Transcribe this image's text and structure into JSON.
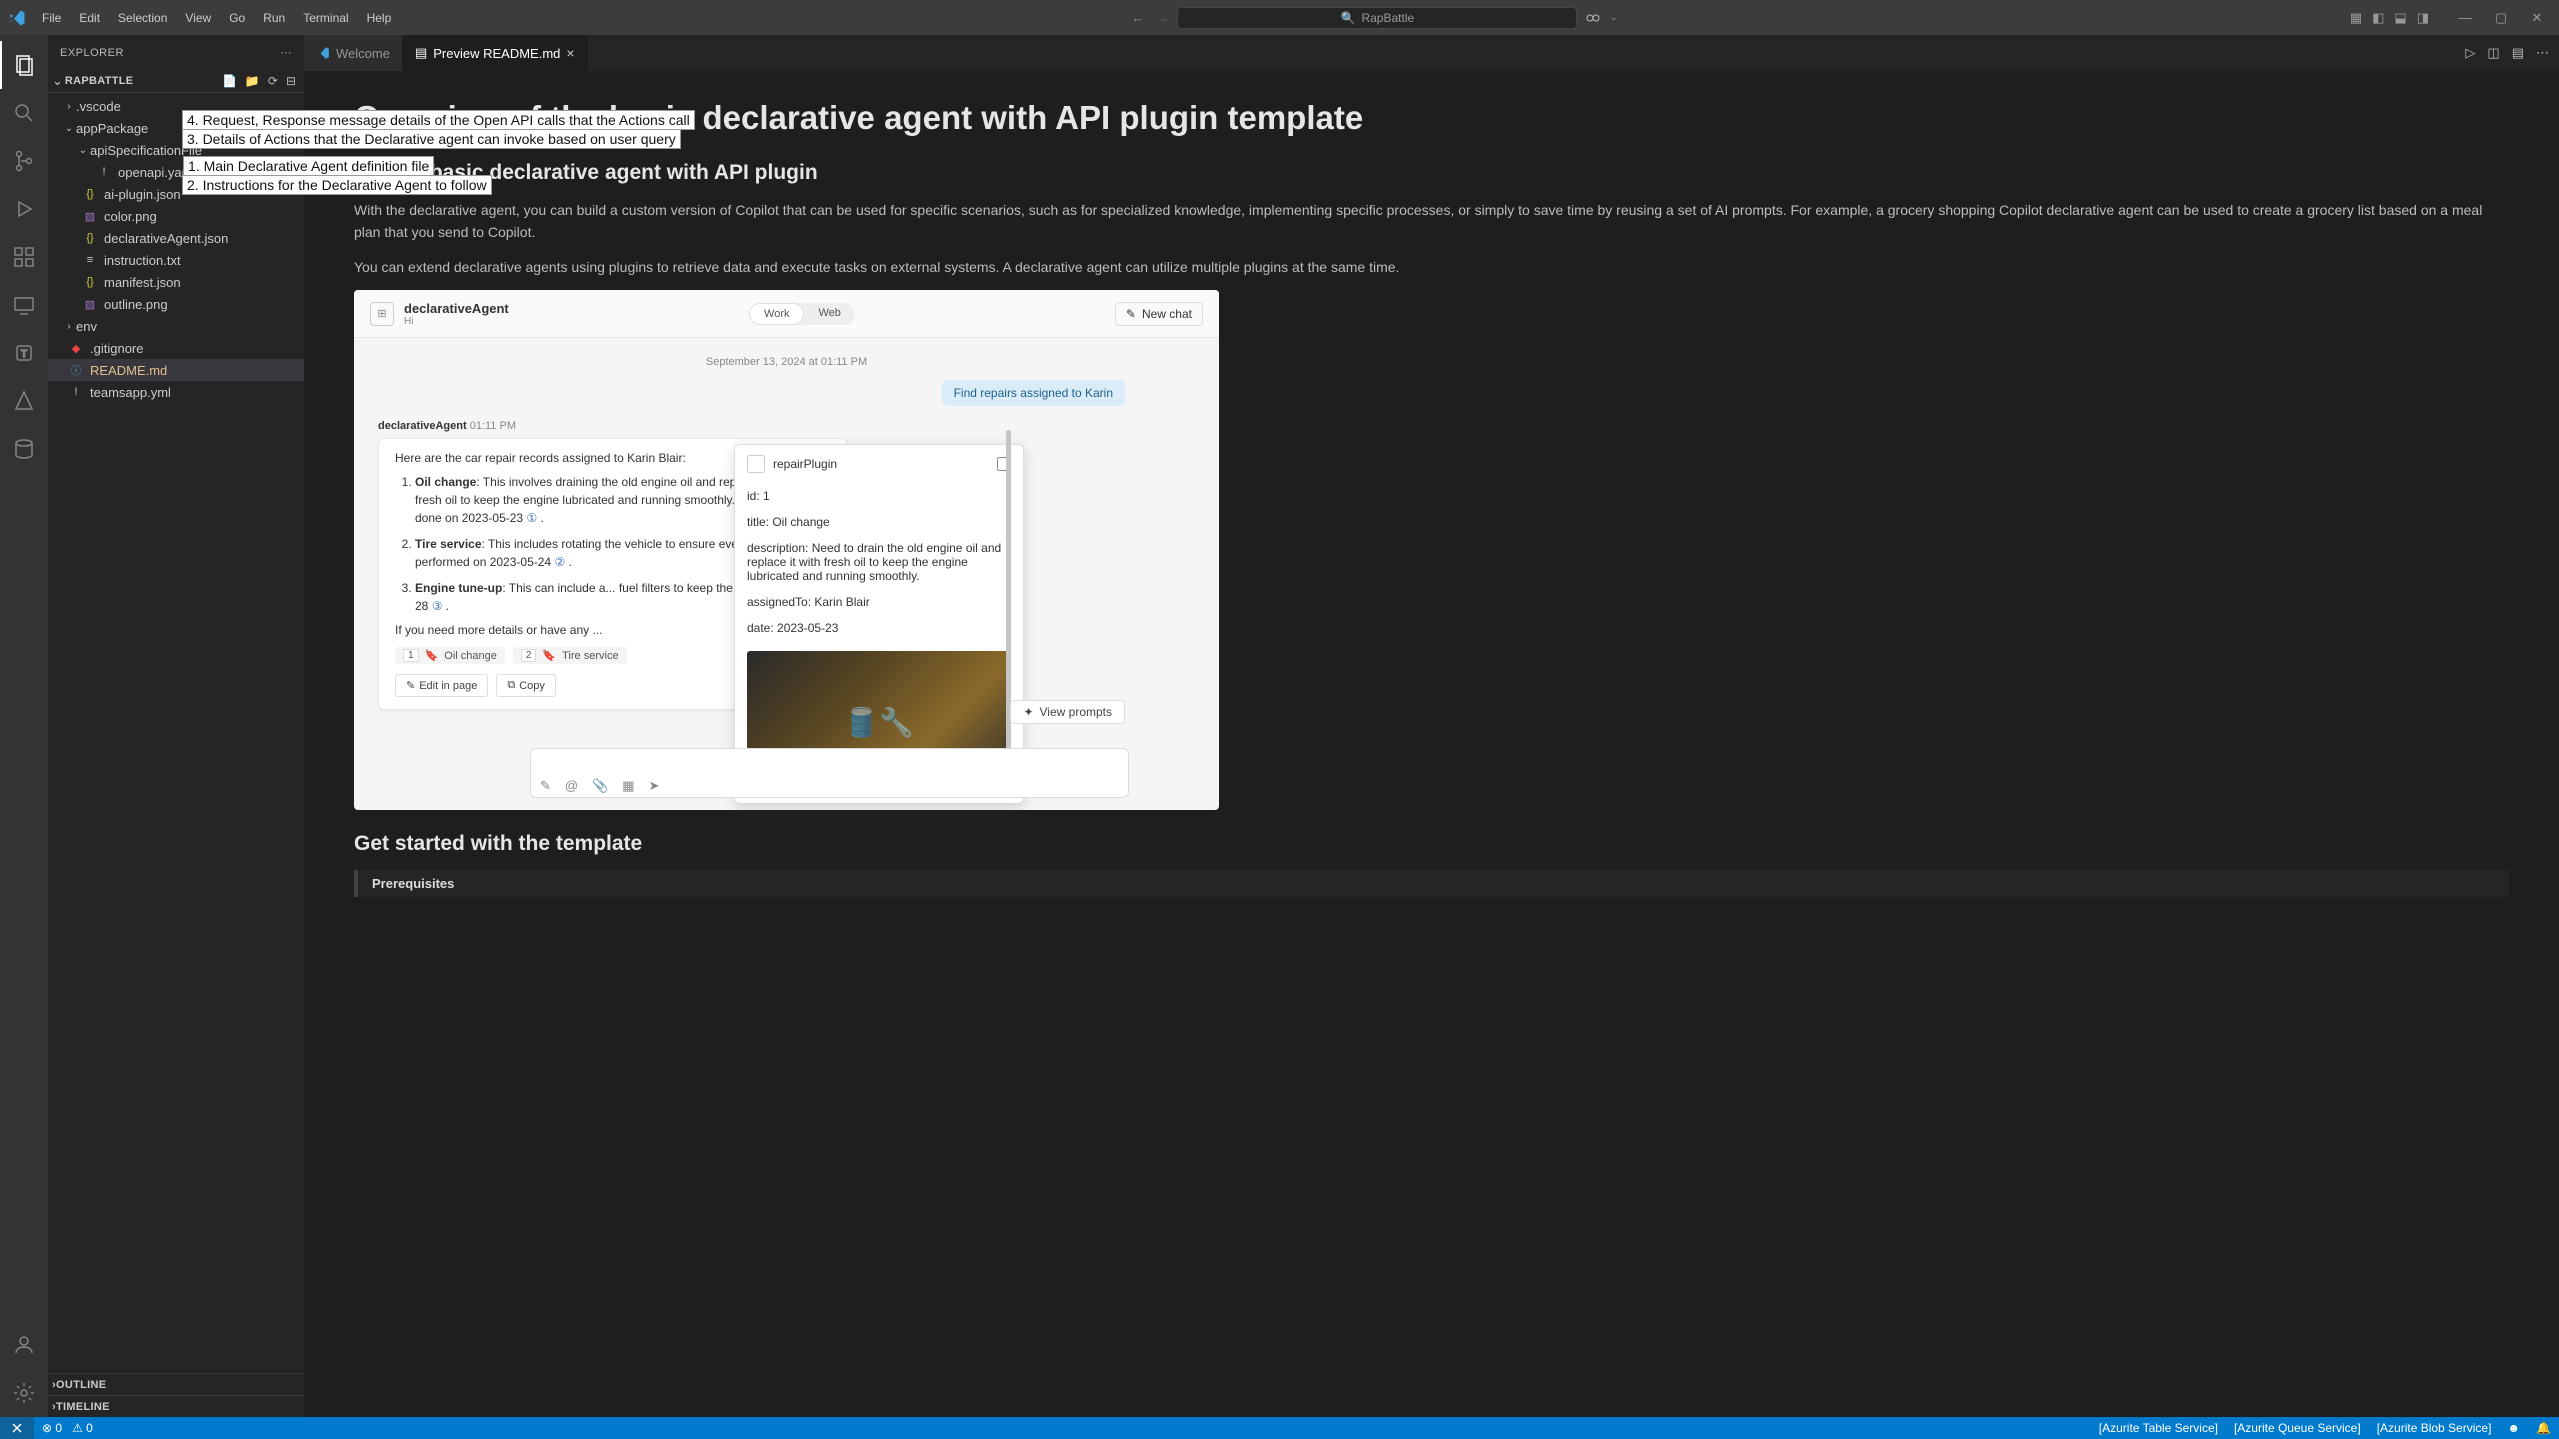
{
  "menu": {
    "items": [
      "File",
      "Edit",
      "Selection",
      "View",
      "Go",
      "Run",
      "Terminal",
      "Help"
    ]
  },
  "search_text": "RapBattle",
  "explorer_label": "EXPLORER",
  "project_name": "RAPBATTLE",
  "tree": {
    "vscode": ".vscode",
    "appPackage": "appPackage",
    "apiSpec": "apiSpecificationFile",
    "openapi": "openapi.yaml",
    "aiPlugin": "ai-plugin.json",
    "color": "color.png",
    "declarativeAgent": "declarativeAgent.json",
    "instruction": "instruction.txt",
    "manifest": "manifest.json",
    "outline": "outline.png",
    "env": "env",
    "gitignore": ".gitignore",
    "readme": "README.md",
    "teamsapp": "teamsapp.yml"
  },
  "outline_section": "OUTLINE",
  "timeline_section": "TIMELINE",
  "tabs": {
    "welcome": "Welcome",
    "preview": "Preview README.md"
  },
  "doc": {
    "h1": "Overview of the basic declarative agent with API plugin template",
    "h2a": "Build a basic declarative agent with API plugin",
    "p1": "With the declarative agent, you can build a custom version of Copilot that can be used for specific scenarios, such as for specialized knowledge, implementing specific processes, or simply to save time by reusing a set of AI prompts. For example, a grocery shopping Copilot declarative agent can be used to create a grocery list based on a meal plan that you send to Copilot.",
    "p2": "You can extend declarative agents using plugins to retrieve data and execute tasks on external systems. A declarative agent can utilize multiple plugins at the same time.",
    "h2b": "Get started with the template",
    "bq": "Prerequisites"
  },
  "chat": {
    "agent_name": "declarativeAgent",
    "agent_sub": "Hi",
    "work": "Work",
    "web": "Web",
    "new_chat": "New chat",
    "date": "September 13, 2024 at 01:11 PM",
    "user_msg": "Find repairs assigned to Karin",
    "agent_stamp_name": "declarativeAgent",
    "agent_stamp_time": "01:11 PM",
    "intro": "Here are the car repair records assigned to Karin Blair:",
    "item1_title": "Oil change",
    "item1_body": ": This involves draining the old engine oil and replacing it with fresh oil to keep the engine lubricated and running smoothly. The repair was done on 2023-05-23",
    "item2_title": "Tire service",
    "item2_body": ": This includes rotating the vehicle to ensure even wear, an... performed on 2023-05-24",
    "item3_title": "Engine tune-up",
    "item3_body": ": This can include a... fuel filters to keep the engine runn... 05-28",
    "more": "If you need more details or have any ...",
    "chip1": "Oil change",
    "chip2": "Tire service",
    "edit": "Edit in page",
    "copy": "Copy",
    "view_prompts": "View prompts",
    "popover": {
      "plugin": "repairPlugin",
      "id": "id: 1",
      "title": "title: Oil change",
      "desc": "description: Need to drain the old engine oil and replace it with fresh oil to keep the engine lubricated and running smoothly.",
      "assigned": "assignedTo: Karin Blair",
      "date": "date: 2023-05-23"
    }
  },
  "annotations": {
    "n1": "1. Main Declarative Agent definition file",
    "n2": "2. Instructions for the Declarative Agent to follow",
    "n3": "3. Details of Actions that the Declarative agent can invoke based on user query",
    "n4": "4. Request, Response message details of the Open API calls that the Actions call"
  },
  "status": {
    "errors": "0",
    "warnings": "0",
    "azurite_table": "[Azurite Table Service]",
    "azurite_queue": "[Azurite Queue Service]",
    "azurite_blob": "[Azurite Blob Service]"
  }
}
